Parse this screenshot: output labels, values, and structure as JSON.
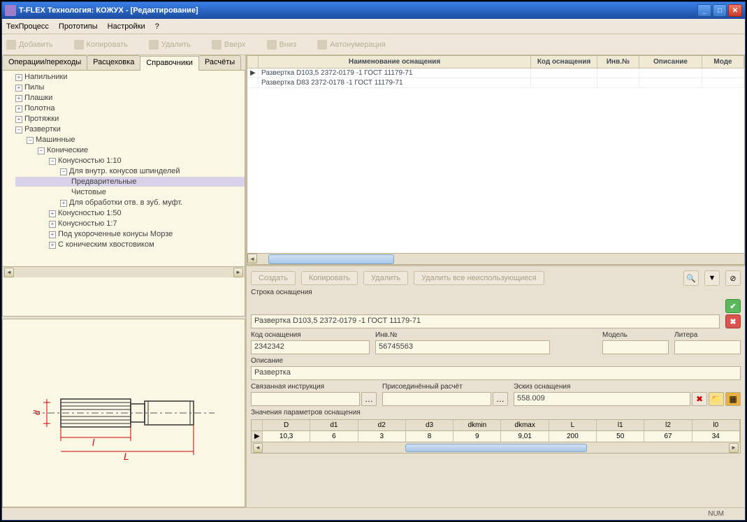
{
  "window": {
    "title": "T-FLEX Технология: КОЖУХ - [Редактирование]"
  },
  "menu": {
    "m1": "ТехПроцесс",
    "m2": "Прототипы",
    "m3": "Настройки",
    "m4": "?"
  },
  "toolbar": {
    "b1": "Добавить",
    "b2": "Копировать",
    "b3": "Удалить",
    "b4": "Вверх",
    "b5": "Вниз",
    "b6": "Автонумерация"
  },
  "tabs": {
    "t1": "Операции/переходы",
    "t2": "Расцеховка",
    "t3": "Справочники",
    "t4": "Расчёты"
  },
  "tree": {
    "n0": "Напильники",
    "n1": "Пилы",
    "n2": "Плашки",
    "n3": "Полотна",
    "n4": "Протяжки",
    "n5": "Развертки",
    "n6": "Машинные",
    "n7": "Конические",
    "n8": "Конусностью 1:10",
    "n9": "Для внутр. конусов шпинделей",
    "n10": "Предварительные",
    "n11": "Чистовые",
    "n12": "Для обработки отв. в зуб. муфт.",
    "n13": "Конусностью 1:50",
    "n14": "Конусностью 1:7",
    "n15": "Под укороченные конусы Морзе",
    "n16": "С коническим хвостовиком"
  },
  "grid": {
    "h1": "Наименование оснащения",
    "h2": "Код оснащения",
    "h3": "Инв.№",
    "h4": "Описание",
    "h5": "Моде",
    "r1c1": "Развертка D103,5 2372-0179 -1 ГОСТ 11179-71",
    "r2c1": "Развертка D83 2372-0178 -1 ГОСТ 11179-71"
  },
  "detail": {
    "btn_create": "Создать",
    "btn_copy": "Копировать",
    "btn_delete": "Удалить",
    "btn_delunused": "Удалить все неиспользующиеся",
    "lbl_row": "Строка оснащения",
    "val_row": "Развертка D103,5 2372-0179 -1 ГОСТ 11179-71",
    "lbl_code": "Код оснащения",
    "val_code": "2342342",
    "lbl_inv": "Инв.№",
    "val_inv": "56745563",
    "lbl_model": "Модель",
    "val_model": "",
    "lbl_litera": "Литера",
    "val_litera": "",
    "lbl_desc": "Описание",
    "val_desc": "Развертка",
    "lbl_instr": "Связанная инструкция",
    "lbl_calc": "Присоединённый расчёт",
    "lbl_sketch": "Эскиз оснащения",
    "val_sketch": "558.009",
    "lbl_params": "Значения параметров оснащения"
  },
  "params": {
    "h": [
      "D",
      "d1",
      "d2",
      "d3",
      "dkmin",
      "dkmax",
      "L",
      "l1",
      "l2",
      "l0"
    ],
    "r": [
      "10,3",
      "6",
      "3",
      "8",
      "9",
      "9,01",
      "200",
      "50",
      "67",
      "34"
    ]
  },
  "status": {
    "num": "NUM"
  }
}
